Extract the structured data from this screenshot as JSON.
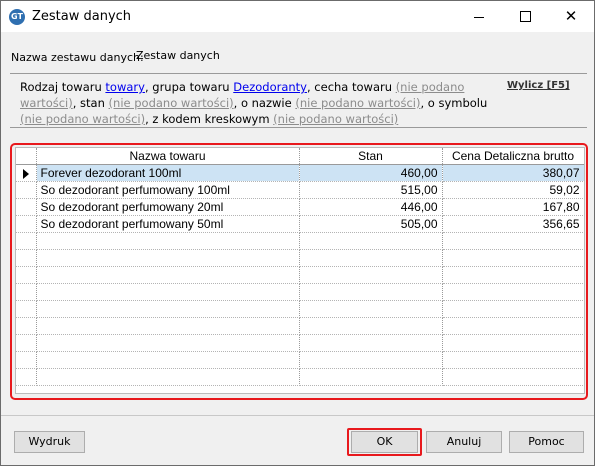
{
  "window": {
    "title": "Zestaw danych",
    "icon_text": "GT",
    "minimize_glyph": "",
    "close_glyph": "✕"
  },
  "dataset": {
    "name_label": "Nazwa zestawu danych:",
    "name_value": "Zestaw danych"
  },
  "description": {
    "t1": "Rodzaj towaru ",
    "kind_link": "towary",
    "t2": ", grupa towaru ",
    "group_link": "Dezodoranty",
    "t3": ", cecha towaru ",
    "feature_link": "(nie podano wartości)",
    "t4": ", stan ",
    "stock_link": "(nie podano wartości)",
    "t5": ", o nazwie ",
    "name_link": "(nie podano wartości)",
    "t6": ", o symbolu ",
    "symbol_link": "(nie podano wartości)",
    "t7": ", z kodem kreskowym ",
    "barcode_link": "(nie podano wartości)",
    "calculate_label": "Wylicz [F5]"
  },
  "grid": {
    "columns": [
      "Nazwa towaru",
      "Stan",
      "Cena Detaliczna brutto"
    ],
    "rows": [
      {
        "name": "Forever dezodorant 100ml",
        "stock": "460,00",
        "price": "380,07"
      },
      {
        "name": "So dezodorant perfumowany 100ml",
        "stock": "515,00",
        "price": "59,02"
      },
      {
        "name": "So dezodorant perfumowany 20ml",
        "stock": "446,00",
        "price": "167,80"
      },
      {
        "name": "So dezodorant perfumowany 50ml",
        "stock": "505,00",
        "price": "356,65"
      }
    ],
    "selected_row": 0
  },
  "buttons": {
    "print": "Wydruk",
    "ok": "OK",
    "cancel": "Anuluj",
    "help": "Pomoc"
  },
  "colors": {
    "highlight": "#e8191d",
    "selection": "#cde3f4",
    "link": "#0000ee",
    "unset": "#8c8c8c"
  }
}
